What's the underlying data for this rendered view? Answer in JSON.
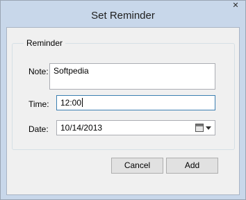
{
  "window": {
    "title": "Set Reminder",
    "close_glyph": "✕"
  },
  "group": {
    "label": "Reminder"
  },
  "note": {
    "label": "Note:",
    "value": "Softpedia"
  },
  "time": {
    "label": "Time:",
    "value": "12:00"
  },
  "date": {
    "label": "Date:",
    "value": "10/14/2013",
    "icon": "calendar-icon"
  },
  "buttons": {
    "cancel_label": "Cancel",
    "add_label": "Add"
  }
}
